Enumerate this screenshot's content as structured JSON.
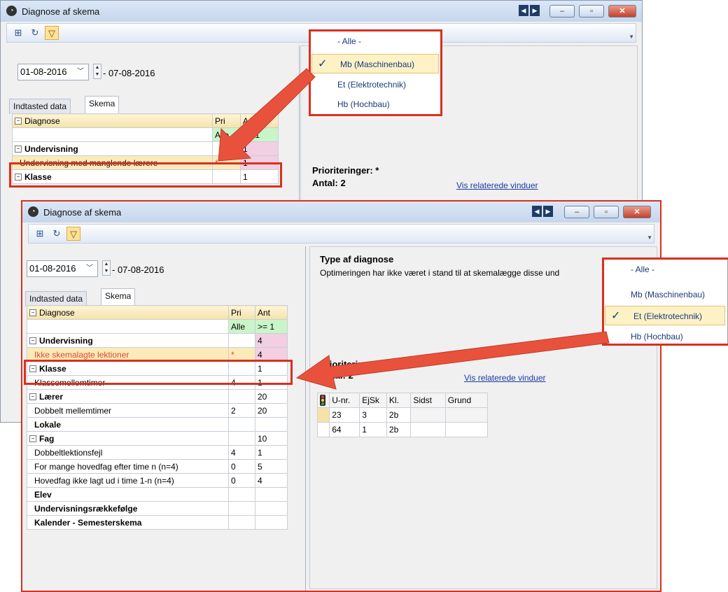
{
  "window_title": "Diagnose af skema",
  "icons": {
    "app": "clock-icon",
    "expand": "expand-icon",
    "refresh": "refresh-icon",
    "filter": "filter-icon"
  },
  "colors": {
    "accent_red": "#d9301f",
    "highlight_yellow": "#fcebb9",
    "pink_cell": "#f2cfe2",
    "green_cell": "#c9f5c9",
    "link": "#1a3aa8"
  },
  "date_from": "01-08-2016",
  "date_to": "07-08-2016",
  "tabs": [
    "Indtasted data",
    "Skema"
  ],
  "grid_headers": {
    "diagnose": "Diagnose",
    "pri": "Pri",
    "ant": "Ant"
  },
  "filter_row": {
    "pri": "Alle",
    "ant": ">= 1"
  },
  "back_header_ant": "A..",
  "back_filter": {
    "pri": "Alle",
    "ant": ">= 1"
  },
  "back_rows": [
    {
      "name": "Undervisning",
      "pri": "",
      "ant": "1"
    },
    {
      "name": "Undervisning med manglende lærere",
      "pri": "*",
      "ant": "1"
    },
    {
      "name": "Klasse",
      "pri": "",
      "ant": "1"
    }
  ],
  "front_rows": [
    {
      "name": "Undervisning",
      "pri": "",
      "ant": "4"
    },
    {
      "name": "Ikke skemalagte lektioner",
      "pri": "*",
      "ant": "4"
    },
    {
      "name": "Klasse",
      "pri": "",
      "ant": "1"
    },
    {
      "name": "Klassemellemtimer",
      "pri": "4",
      "ant": "1"
    },
    {
      "name": "Lærer",
      "pri": "",
      "ant": "20"
    },
    {
      "name": "Dobbelt mellemtimer",
      "pri": "2",
      "ant": "20"
    },
    {
      "name": "Lokale",
      "pri": "",
      "ant": ""
    },
    {
      "name": "Fag",
      "pri": "",
      "ant": "10"
    },
    {
      "name": "Dobbeltlektionsfejl",
      "pri": "4",
      "ant": "1"
    },
    {
      "name": "For mange hovedfag efter time n (n=4)",
      "pri": "0",
      "ant": "5"
    },
    {
      "name": "Hovedfag ikke lagt ud i time 1-n (n=4)",
      "pri": "0",
      "ant": "4"
    },
    {
      "name": "Elev",
      "pri": "",
      "ant": ""
    },
    {
      "name": "Undervisningsrækkefølge",
      "pri": "",
      "ant": ""
    },
    {
      "name": "Kalender - Semesterskema",
      "pri": "",
      "ant": ""
    }
  ],
  "menu_items": [
    "- Alle -",
    "Mb (Maschinenbau)",
    "Et (Elektrotechnik)",
    "Hb (Hochbau)"
  ],
  "check_mark": "✓",
  "back_right": {
    "prior_label": "Prioriteringer: *",
    "antal_label": "Antal: 2",
    "link": "Vis relaterede vinduer"
  },
  "front_right": {
    "type_title": "Type af diagnose",
    "description": "Optimeringen har ikke været i stand til at skemalægge disse und",
    "prior_label": "Prioriteringer: *",
    "antal_label": "Antal: 2",
    "link": "Vis relaterede vinduer"
  },
  "result_headers": [
    "U-nr.",
    "EjSk",
    "Kl.",
    "Sidst",
    "Grund"
  ],
  "result_rows": [
    [
      "23",
      "3",
      "2b",
      "",
      ""
    ],
    [
      "64",
      "1",
      "2b",
      "",
      ""
    ]
  ]
}
